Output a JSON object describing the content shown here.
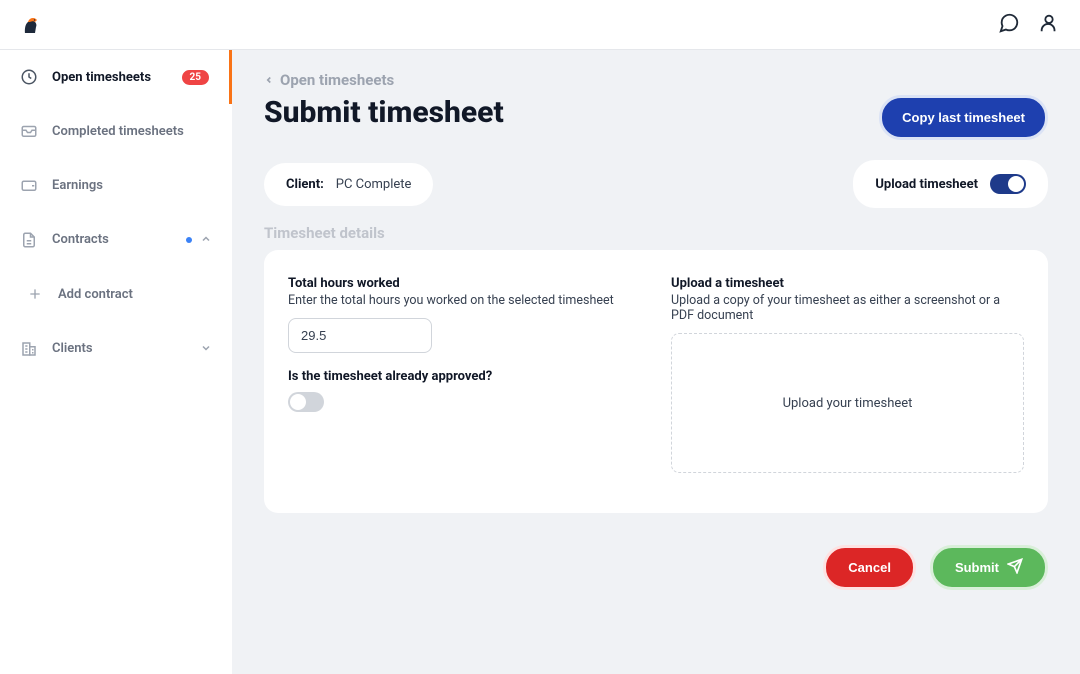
{
  "header": {},
  "sidebar": {
    "items": [
      {
        "label": "Open timesheets",
        "badge": "25"
      },
      {
        "label": "Completed timesheets"
      },
      {
        "label": "Earnings"
      },
      {
        "label": "Contracts"
      },
      {
        "label": "Add contract"
      },
      {
        "label": "Clients"
      }
    ]
  },
  "breadcrumb": {
    "label": "Open timesheets"
  },
  "page": {
    "title": "Submit timesheet",
    "copy_last_label": "Copy last timesheet"
  },
  "client": {
    "label": "Client:",
    "value": "PC Complete"
  },
  "upload_toggle": {
    "label": "Upload timesheet"
  },
  "section": {
    "title": "Timesheet details"
  },
  "total_hours": {
    "label": "Total hours worked",
    "help": "Enter the total hours you worked on the selected timesheet",
    "value": "29.5"
  },
  "approved": {
    "label": "Is the timesheet already approved?"
  },
  "upload": {
    "label": "Upload a timesheet",
    "help": "Upload a copy of your timesheet as either a screenshot or a PDF document",
    "placeholder": "Upload your timesheet"
  },
  "actions": {
    "cancel": "Cancel",
    "submit": "Submit"
  }
}
